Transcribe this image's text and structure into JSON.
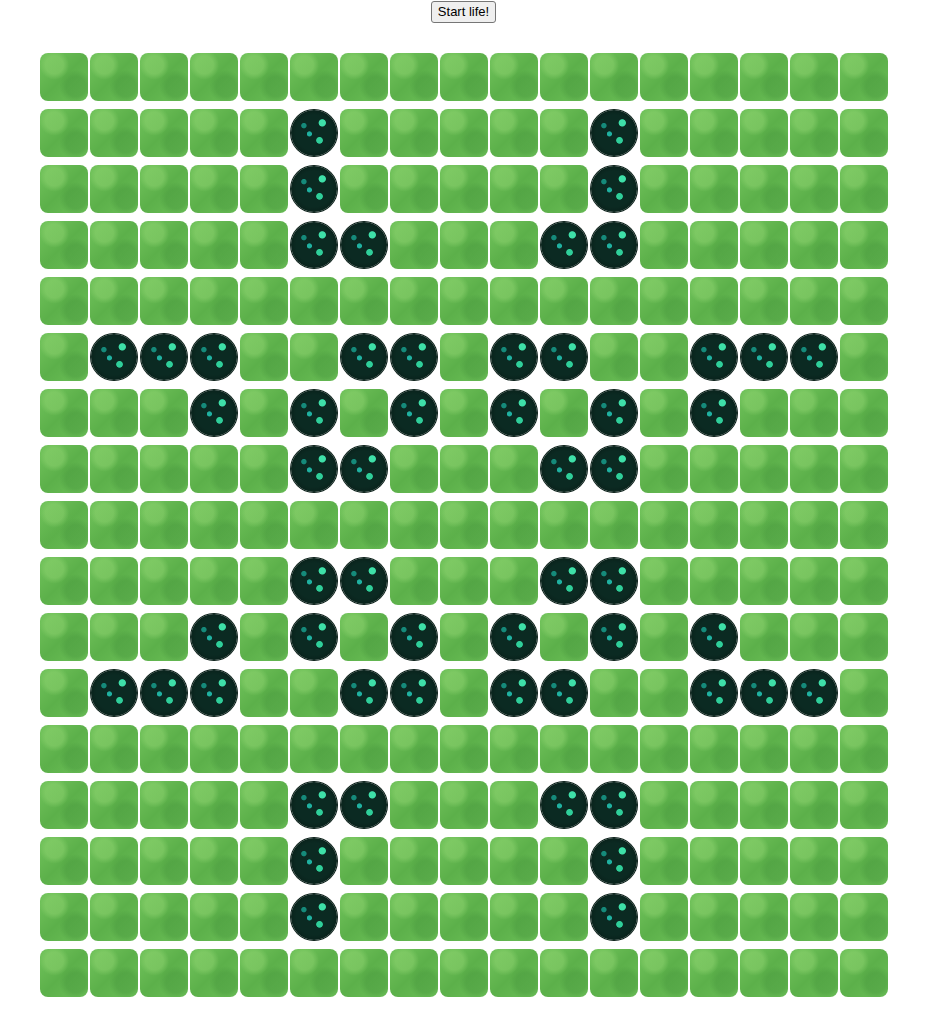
{
  "button": "Start life!",
  "grid": [
    [
      false,
      false,
      false,
      false,
      false,
      false,
      false,
      false,
      false,
      false,
      false,
      false,
      false,
      false,
      false,
      false,
      false
    ],
    [
      false,
      false,
      false,
      false,
      false,
      true,
      false,
      false,
      false,
      false,
      false,
      true,
      false,
      false,
      false,
      false,
      false
    ],
    [
      false,
      false,
      false,
      false,
      false,
      true,
      false,
      false,
      false,
      false,
      false,
      true,
      false,
      false,
      false,
      false,
      false
    ],
    [
      false,
      false,
      false,
      false,
      false,
      true,
      true,
      false,
      false,
      false,
      true,
      true,
      false,
      false,
      false,
      false,
      false
    ],
    [
      false,
      false,
      false,
      false,
      false,
      false,
      false,
      false,
      false,
      false,
      false,
      false,
      false,
      false,
      false,
      false,
      false
    ],
    [
      false,
      true,
      true,
      true,
      false,
      false,
      true,
      true,
      false,
      true,
      true,
      false,
      false,
      true,
      true,
      true,
      false
    ],
    [
      false,
      false,
      false,
      true,
      false,
      true,
      false,
      true,
      false,
      true,
      false,
      true,
      false,
      true,
      false,
      false,
      false
    ],
    [
      false,
      false,
      false,
      false,
      false,
      true,
      true,
      false,
      false,
      false,
      true,
      true,
      false,
      false,
      false,
      false,
      false
    ],
    [
      false,
      false,
      false,
      false,
      false,
      false,
      false,
      false,
      false,
      false,
      false,
      false,
      false,
      false,
      false,
      false,
      false
    ],
    [
      false,
      false,
      false,
      false,
      false,
      true,
      true,
      false,
      false,
      false,
      true,
      true,
      false,
      false,
      false,
      false,
      false
    ],
    [
      false,
      false,
      false,
      true,
      false,
      true,
      false,
      true,
      false,
      true,
      false,
      true,
      false,
      true,
      false,
      false,
      false
    ],
    [
      false,
      true,
      true,
      true,
      false,
      false,
      true,
      true,
      false,
      true,
      true,
      false,
      false,
      true,
      true,
      true,
      false
    ],
    [
      false,
      false,
      false,
      false,
      false,
      false,
      false,
      false,
      false,
      false,
      false,
      false,
      false,
      false,
      false,
      false,
      false
    ],
    [
      false,
      false,
      false,
      false,
      false,
      true,
      true,
      false,
      false,
      false,
      true,
      true,
      false,
      false,
      false,
      false,
      false
    ],
    [
      false,
      false,
      false,
      false,
      false,
      true,
      false,
      false,
      false,
      false,
      false,
      true,
      false,
      false,
      false,
      false,
      false
    ],
    [
      false,
      false,
      false,
      false,
      false,
      true,
      false,
      false,
      false,
      false,
      false,
      true,
      false,
      false,
      false,
      false,
      false
    ],
    [
      false,
      false,
      false,
      false,
      false,
      false,
      false,
      false,
      false,
      false,
      false,
      false,
      false,
      false,
      false,
      false,
      false
    ]
  ]
}
